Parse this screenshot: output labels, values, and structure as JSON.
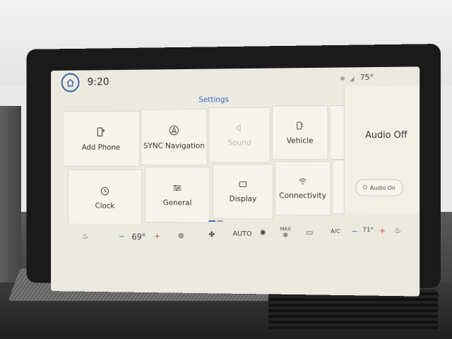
{
  "status": {
    "time": "9:20",
    "outside_temp": "75°"
  },
  "settings": {
    "title": "Settings",
    "tiles": [
      {
        "label": "Add Phone",
        "icon": "phone-plus-icon",
        "enabled": true
      },
      {
        "label": "SYNC Navigation",
        "icon": "navigation-icon",
        "enabled": true
      },
      {
        "label": "Sound",
        "icon": "speaker-icon",
        "enabled": false
      },
      {
        "label": "Vehicle",
        "icon": "vehicle-icon",
        "enabled": true
      },
      {
        "label": "Clock",
        "icon": "clock-icon",
        "enabled": true
      },
      {
        "label": "General",
        "icon": "sliders-icon",
        "enabled": true
      },
      {
        "label": "Display",
        "icon": "display-icon",
        "enabled": true
      },
      {
        "label": "Connectivity",
        "icon": "wifi-icon",
        "enabled": true
      }
    ]
  },
  "audio": {
    "status": "Audio Off",
    "button_label": "Audio On"
  },
  "climate": {
    "driver_temp": "69°",
    "passenger_temp": "71°",
    "auto_label": "AUTO",
    "max_label": "MAX",
    "ac_label": "A/C",
    "minus": "−",
    "plus": "+"
  },
  "colors": {
    "accent": "#2d6bc2",
    "heat": "#d23a2d",
    "screen_bg": "#ece9df"
  }
}
